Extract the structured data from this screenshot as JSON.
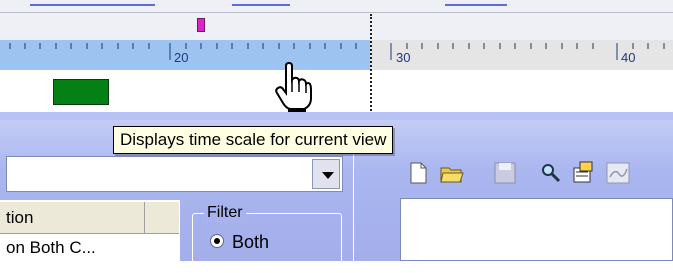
{
  "ruler": {
    "labels": [
      "20",
      "30",
      "40"
    ]
  },
  "tooltip": {
    "text": "Displays time scale for current view"
  },
  "list": {
    "header_label": "tion",
    "row1_text": "on Both C..."
  },
  "filter": {
    "group_label": "Filter",
    "option_both": "Both"
  },
  "icons": [
    "new-doc-icon",
    "open-folder-icon",
    "save-icon",
    "search-icon",
    "properties-icon",
    "graph-icon"
  ],
  "colors": {
    "ruler_highlight": "#9dc3f0",
    "green_bar": "#058015",
    "marker": "#e020c8",
    "tooltip_bg": "#ffffe1",
    "toolbar_band": "#a8b3ee"
  }
}
